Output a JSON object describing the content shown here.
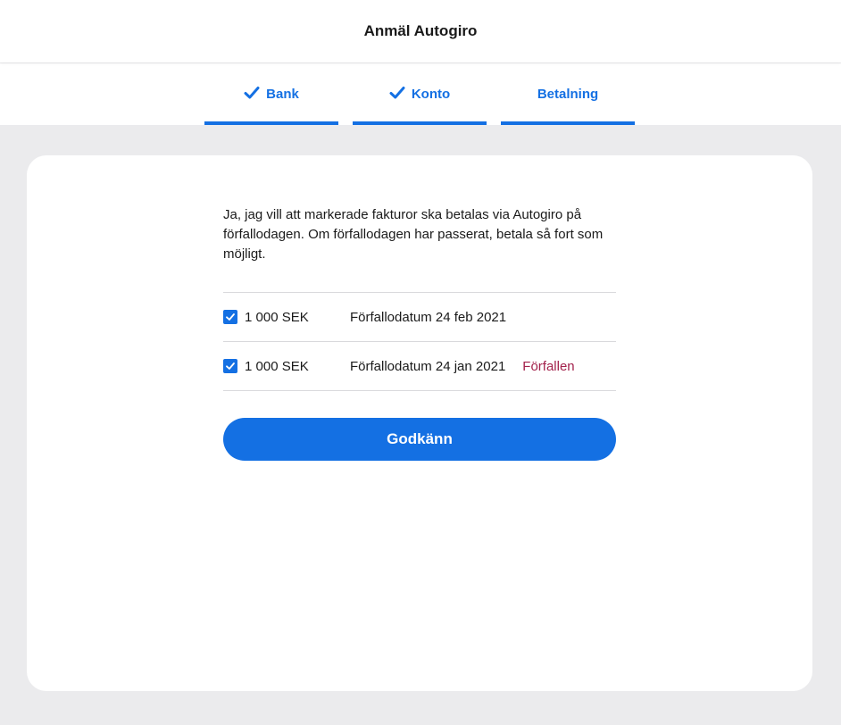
{
  "header": {
    "title": "Anmäl Autogiro"
  },
  "steps": [
    {
      "label": "Bank",
      "completed": true
    },
    {
      "label": "Konto",
      "completed": true
    },
    {
      "label": "Betalning",
      "completed": false
    }
  ],
  "main": {
    "consent_text": "Ja, jag vill att markerade fakturor ska betalas via Autogiro på förfallodagen. Om förfallodagen har passerat, betala så fort som möjligt.",
    "invoices": [
      {
        "checked": true,
        "amount": "1 000 SEK",
        "due": "Förfallodatum 24 feb 2021",
        "status": ""
      },
      {
        "checked": true,
        "amount": "1 000 SEK",
        "due": "Förfallodatum 24 jan 2021",
        "status": "Förfallen"
      }
    ],
    "approve_label": "Godkänn"
  },
  "colors": {
    "accent": "#1470e3",
    "overdue": "#a3224c",
    "background": "#ebebed"
  }
}
